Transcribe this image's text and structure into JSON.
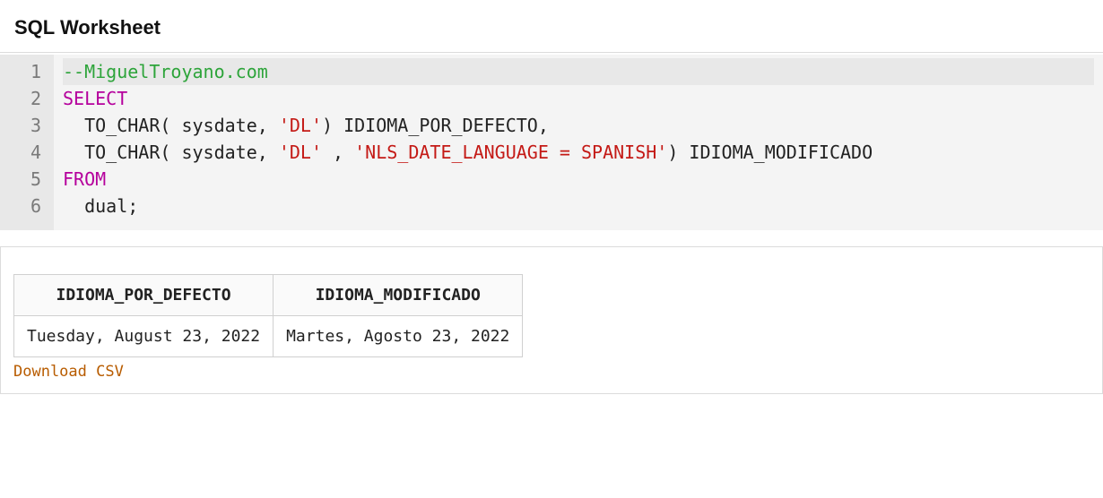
{
  "header": {
    "title": "SQL Worksheet"
  },
  "editor": {
    "line_numbers": [
      "1",
      "2",
      "3",
      "4",
      "5",
      "6"
    ],
    "lines": [
      {
        "tokens": [
          {
            "cls": "tok-comment",
            "t": "--MiguelTroyano.com"
          }
        ],
        "current": true
      },
      {
        "tokens": [
          {
            "cls": "tok-keyword",
            "t": "SELECT"
          }
        ]
      },
      {
        "tokens": [
          {
            "cls": "tok-ident",
            "t": "  TO_CHAR( sysdate, "
          },
          {
            "cls": "tok-string",
            "t": "'DL'"
          },
          {
            "cls": "tok-ident",
            "t": ") IDIOMA_POR_DEFECTO,"
          }
        ]
      },
      {
        "tokens": [
          {
            "cls": "tok-ident",
            "t": "  TO_CHAR( sysdate, "
          },
          {
            "cls": "tok-string",
            "t": "'DL'"
          },
          {
            "cls": "tok-ident",
            "t": " , "
          },
          {
            "cls": "tok-string",
            "t": "'NLS_DATE_LANGUAGE = SPANISH'"
          },
          {
            "cls": "tok-ident",
            "t": ") IDIOMA_MODIFICADO"
          }
        ]
      },
      {
        "tokens": [
          {
            "cls": "tok-keyword",
            "t": "FROM"
          }
        ]
      },
      {
        "tokens": [
          {
            "cls": "tok-ident",
            "t": "  dual;"
          }
        ]
      }
    ]
  },
  "results": {
    "columns": [
      "IDIOMA_POR_DEFECTO",
      "IDIOMA_MODIFICADO"
    ],
    "rows": [
      [
        "Tuesday, August 23, 2022",
        "Martes, Agosto 23, 2022"
      ]
    ],
    "download_label": "Download CSV"
  }
}
